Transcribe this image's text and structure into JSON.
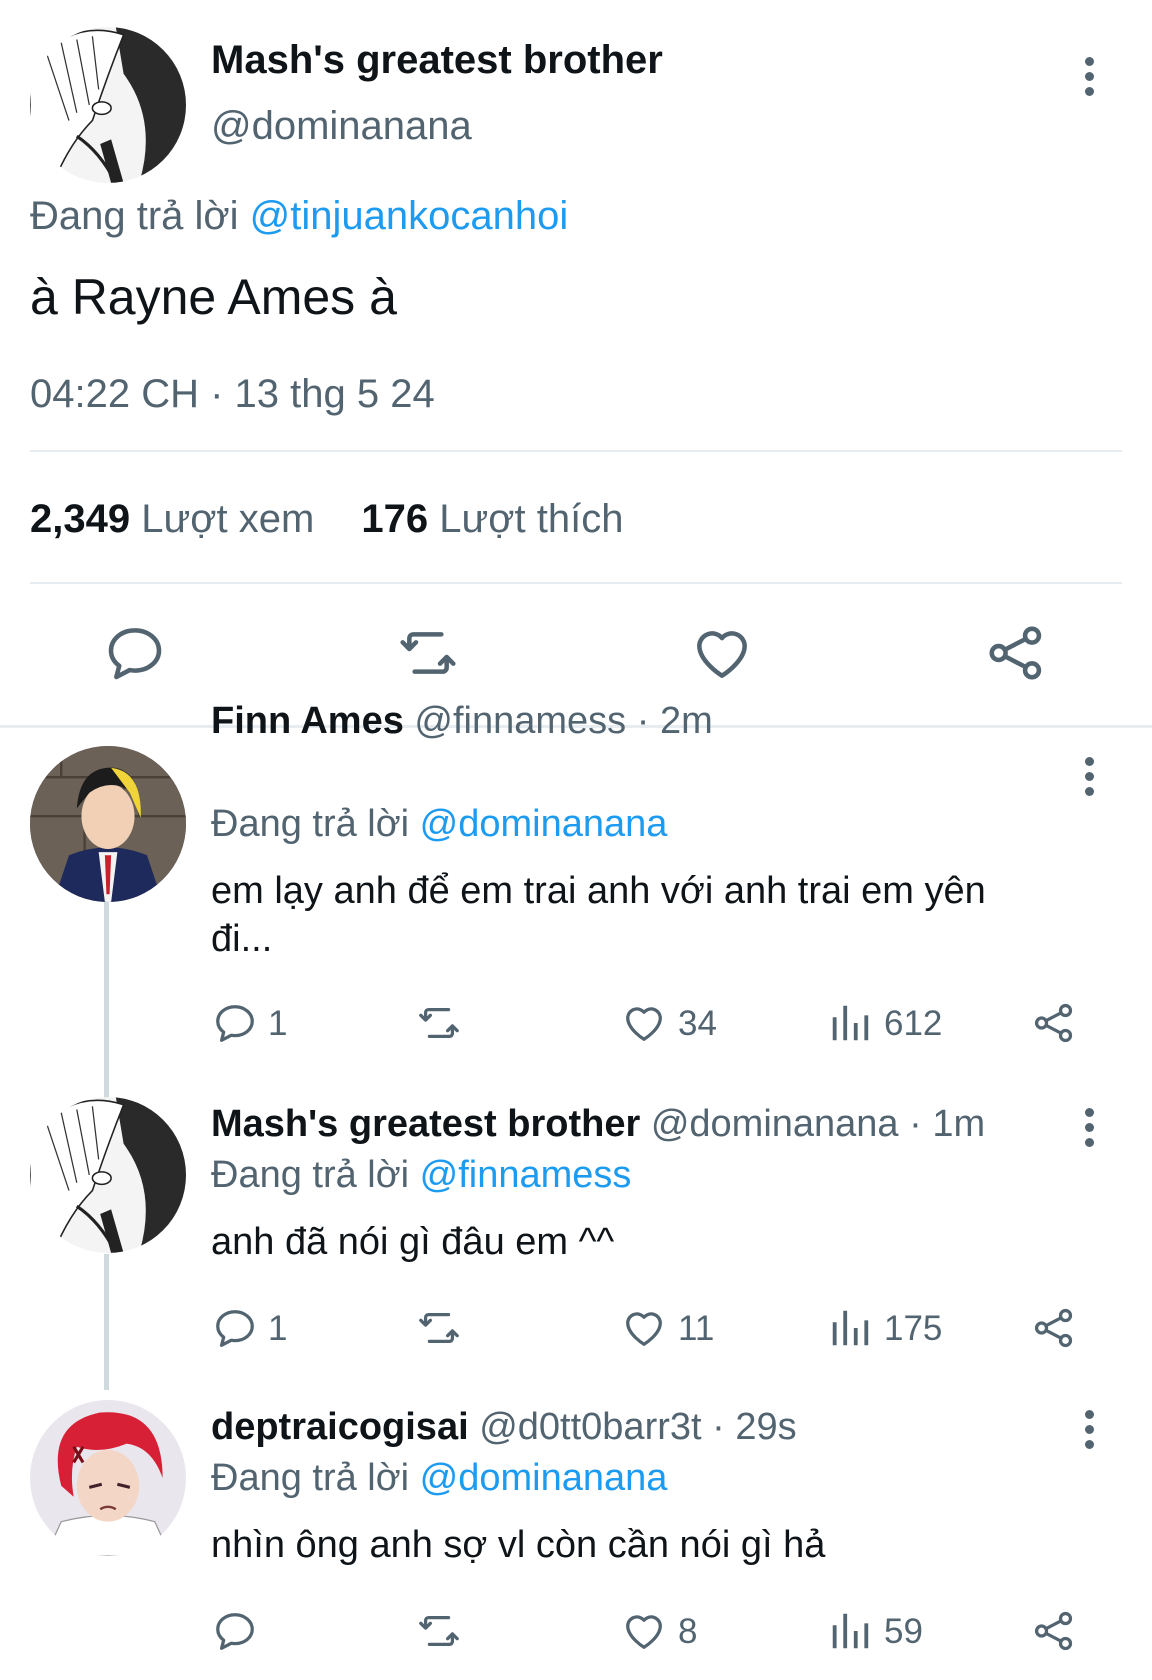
{
  "main_tweet": {
    "display_name": "Mash's greatest brother",
    "handle": "@dominanana",
    "replying_prefix": "Đang trả lời",
    "replying_to": "@tinjuankocanhoi",
    "text": "à Rayne Ames à",
    "timestamp": "04:22 CH · 13 thg 5 24",
    "views_count": "2,349",
    "views_label": "Lượt xem",
    "likes_count": "176",
    "likes_label": "Lượt thích",
    "actions": [
      "reply-icon",
      "retweet-icon",
      "heart-icon",
      "share-icon"
    ]
  },
  "replies": [
    {
      "display_name": "Finn Ames",
      "handle": "@finnamess",
      "time": "· 2m",
      "replying_prefix": "Đang trả lời",
      "replying_to": "@dominanana",
      "text_line1": "em lạy anh để em trai anh với anh trai em yên",
      "text_line2": "đi...",
      "reply_count": "1",
      "like_count": "34",
      "view_count": "612"
    },
    {
      "display_name": "Mash's greatest brother",
      "handle": "@dominanana",
      "time": "· 1m",
      "replying_prefix": "Đang trả lời",
      "replying_to": "@finnamess",
      "text_line1": "anh đã nói gì đâu em ^^",
      "reply_count": "1",
      "like_count": "11",
      "view_count": "175"
    },
    {
      "display_name": "deptraicogisai",
      "handle": "@d0tt0barr3t",
      "time": "· 29s",
      "replying_prefix": "Đang trả lời",
      "replying_to": "@dominanana",
      "text_line1": "nhìn ông anh sợ vl còn cần nói gì hả",
      "reply_count": "",
      "like_count": "8",
      "view_count": "59"
    }
  ],
  "colors": {
    "link": "#1d9bf0",
    "secondary_text": "#536471",
    "divider": "#e6ecf0"
  }
}
